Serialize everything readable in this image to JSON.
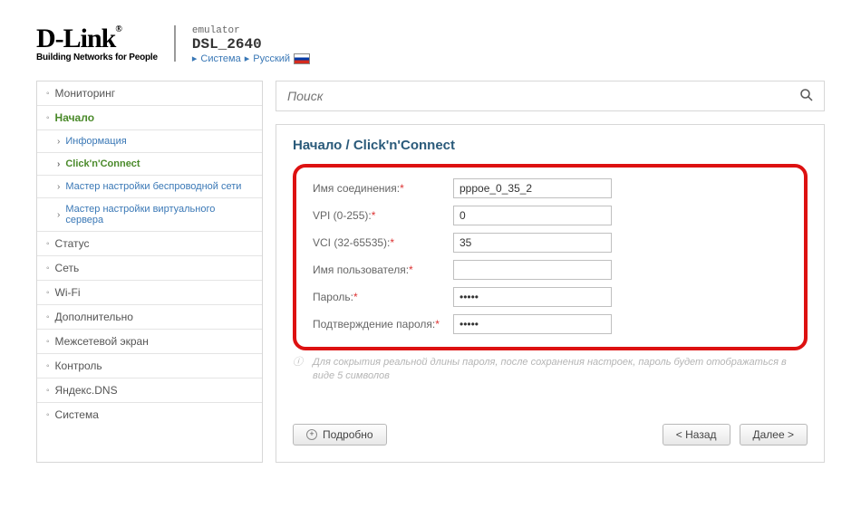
{
  "header": {
    "logo_main": "D-Link",
    "logo_sub": "Building Networks for People",
    "emulator": "emulator",
    "model": "DSL_2640",
    "system_link": "Система",
    "lang_link": "Русский"
  },
  "sidebar": {
    "items": [
      {
        "label": "Мониторинг",
        "type": "top"
      },
      {
        "label": "Начало",
        "type": "top-active"
      },
      {
        "label": "Информация",
        "type": "sub"
      },
      {
        "label": "Click'n'Connect",
        "type": "sub-active"
      },
      {
        "label": "Мастер настройки беспроводной сети",
        "type": "sub"
      },
      {
        "label": "Мастер настройки виртуального сервера",
        "type": "sub"
      },
      {
        "label": "Статус",
        "type": "top"
      },
      {
        "label": "Сеть",
        "type": "top"
      },
      {
        "label": "Wi-Fi",
        "type": "top"
      },
      {
        "label": "Дополнительно",
        "type": "top"
      },
      {
        "label": "Межсетевой экран",
        "type": "top"
      },
      {
        "label": "Контроль",
        "type": "top"
      },
      {
        "label": "Яндекс.DNS",
        "type": "top"
      },
      {
        "label": "Система",
        "type": "top"
      }
    ]
  },
  "search": {
    "placeholder": "Поиск"
  },
  "main": {
    "breadcrumb": "Начало / Click'n'Connect",
    "form": {
      "conn_name_label": "Имя соединения:",
      "conn_name_value": "pppoe_0_35_2",
      "vpi_label": "VPI (0-255):",
      "vpi_value": "0",
      "vci_label": "VCI (32-65535):",
      "vci_value": "35",
      "user_label": "Имя пользователя:",
      "user_value": "",
      "pass_label": "Пароль:",
      "pass_value": "•••••",
      "pass2_label": "Подтверждение пароля:",
      "pass2_value": "•••••"
    },
    "note": "Для сокрытия реальной длины пароля, после сохранения настроек, пароль будет отображаться в виде 5 символов",
    "buttons": {
      "more": "Подробно",
      "back": "< Назад",
      "next": "Далее >"
    }
  }
}
